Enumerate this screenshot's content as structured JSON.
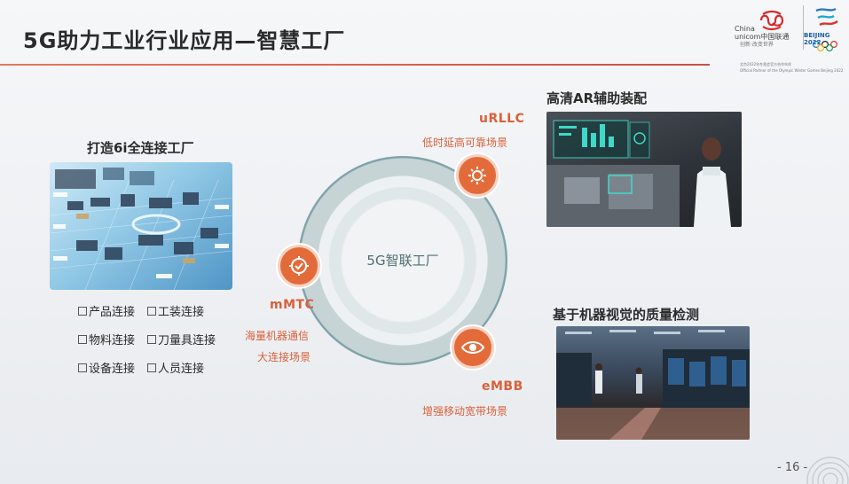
{
  "slide": {
    "title": "5G助力工业行业应用—智慧工厂",
    "page_number": "- 16 -"
  },
  "brand": {
    "unicom_text_1": "China",
    "unicom_text_2": "unicom中国联通",
    "unicom_slogan": "创新·改变世界",
    "olympic_text": "BEIJING 2022",
    "partner_cn": "北京2022年冬奥会官方合作伙伴",
    "partner_en": "Official Partner of the Olympic Winter Games Beijing 2022",
    "accent_red": "#d9604a"
  },
  "left": {
    "heading": "打造6i全连接工厂",
    "connections": [
      "产品连接",
      "工装连接",
      "物料连接",
      "刀量具连接",
      "设备连接",
      "人员连接"
    ]
  },
  "center": {
    "label": "5G智联工厂",
    "features": {
      "urllc": {
        "title": "uRLLC",
        "subtitle": "低时延高可靠场景",
        "icon": "gear-icon"
      },
      "mmtc": {
        "title": "mMTC",
        "subtitle_1": "海量机器通信",
        "subtitle_2": "大连接场景",
        "icon": "shield-gear-icon"
      },
      "embb": {
        "title": "eMBB",
        "subtitle": "增强移动宽带场景",
        "icon": "eye-icon"
      }
    },
    "accent": "#e36b3a"
  },
  "right": {
    "top_heading": "高清AR辅助装配",
    "bottom_heading": "基于机器视觉的质量检测"
  }
}
